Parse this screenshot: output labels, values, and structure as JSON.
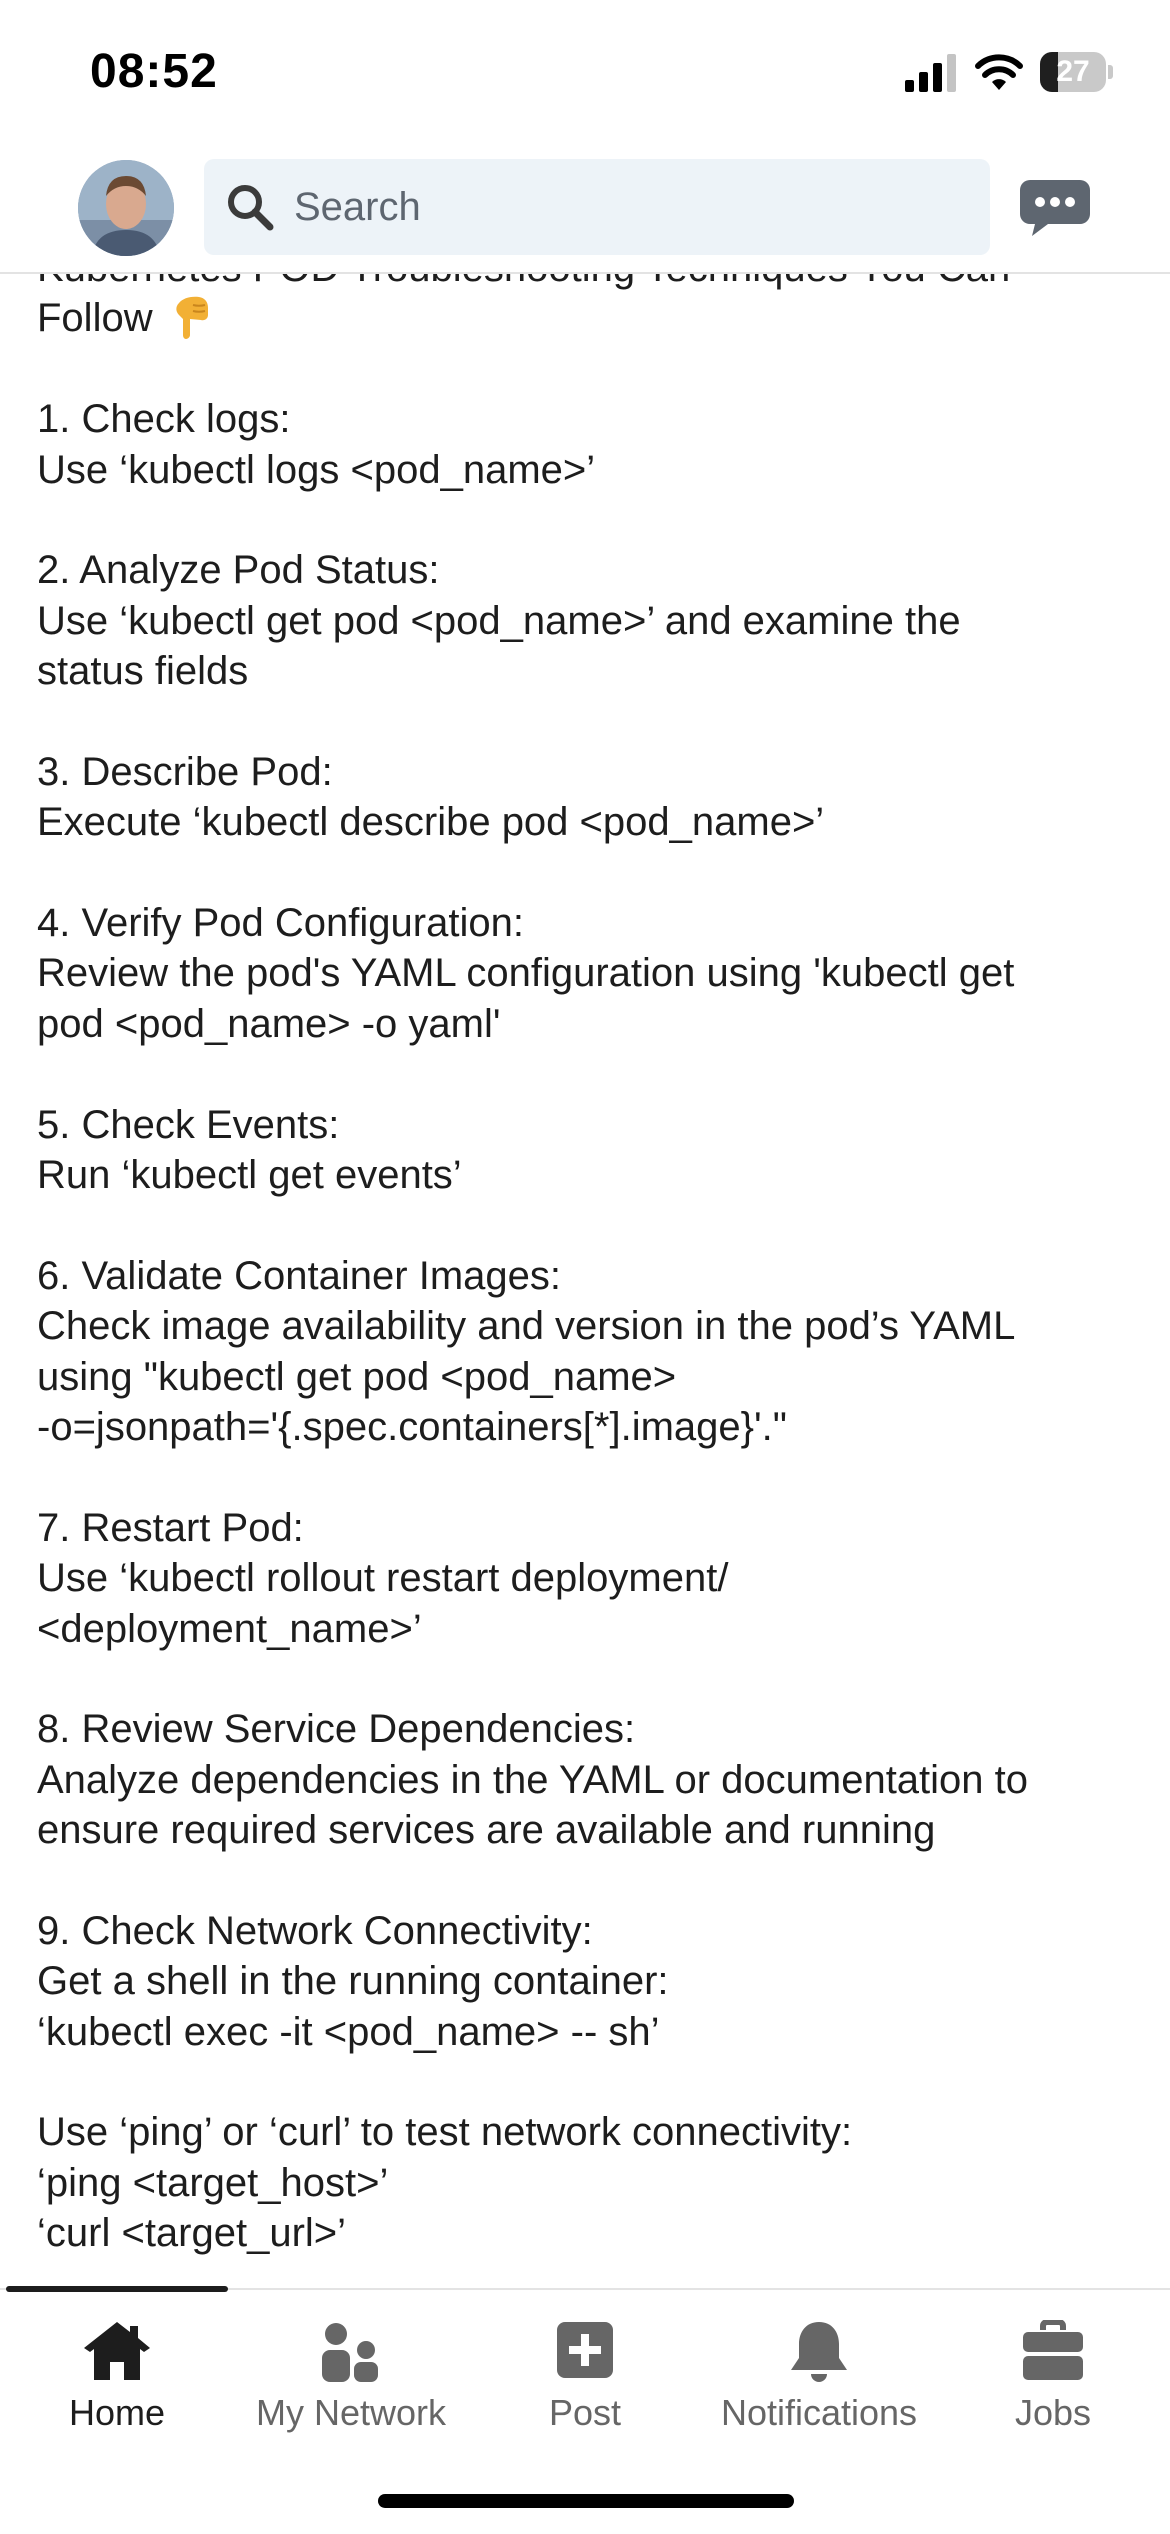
{
  "status_bar": {
    "time": "08:52",
    "battery_level": "27",
    "battery_fraction": 0.27,
    "icons": [
      "signal-icon",
      "wifi-icon",
      "battery-icon"
    ]
  },
  "header": {
    "search_placeholder": "Search",
    "icons": [
      "search-icon",
      "messaging-icon"
    ]
  },
  "post": {
    "lines": [
      "Kubernetes POD Troubleshooting Techniques You Can",
      "Follow",
      "",
      "1. Check logs:",
      "Use ‘kubectl logs <pod_name>’",
      "",
      "2. Analyze Pod Status:",
      "Use ‘kubectl get pod <pod_name>’ and examine the",
      "status fields",
      "",
      "3. Describe Pod:",
      "Execute ‘kubectl describe pod <pod_name>’",
      "",
      "4. Verify Pod Configuration:",
      "Review the pod's YAML configuration using 'kubectl get",
      "pod <pod_name> -o yaml'",
      "",
      "5. Check Events:",
      "Run ‘kubectl get events’",
      "",
      "6. Validate Container Images:",
      "Check image availability and version in the pod’s YAML",
      "using \"kubectl get pod <pod_name>",
      "-o=jsonpath='{.spec.containers[*].image}'.\"",
      "",
      "7. Restart Pod:",
      "Use ‘kubectl rollout restart deployment/",
      "<deployment_name>’",
      "",
      "8. Review Service Dependencies:",
      "Analyze dependencies in the YAML or documentation to",
      "ensure required services are available and running",
      "",
      "9. Check Network Connectivity:",
      "Get a shell in the running container:",
      "‘kubectl exec -it <pod_name> -- sh’",
      "",
      "Use ‘ping’ or ‘curl’ to test network connectivity:",
      "‘ping <target_host>’",
      "‘curl <target_url>’"
    ],
    "emoji_icon": "backhand-index-pointing-down-icon"
  },
  "bottom_nav": {
    "items": [
      {
        "label": "Home",
        "icon": "home-icon",
        "active": true
      },
      {
        "label": "My Network",
        "icon": "my-network-icon",
        "active": false
      },
      {
        "label": "Post",
        "icon": "post-icon",
        "active": false
      },
      {
        "label": "Notifications",
        "icon": "notifications-icon",
        "active": false
      },
      {
        "label": "Jobs",
        "icon": "jobs-icon",
        "active": false
      }
    ]
  }
}
